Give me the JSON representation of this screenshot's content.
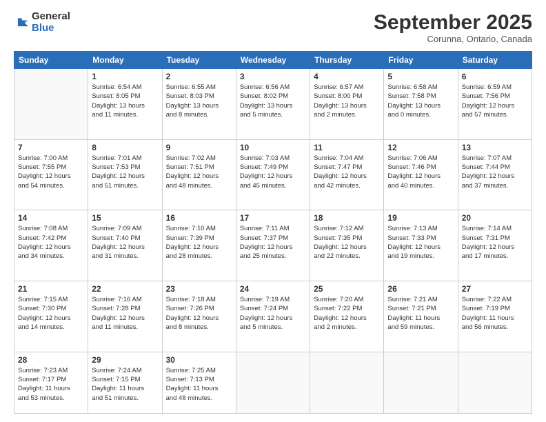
{
  "logo": {
    "general": "General",
    "blue": "Blue"
  },
  "title": "September 2025",
  "location": "Corunna, Ontario, Canada",
  "days_header": [
    "Sunday",
    "Monday",
    "Tuesday",
    "Wednesday",
    "Thursday",
    "Friday",
    "Saturday"
  ],
  "weeks": [
    [
      {
        "day": "",
        "info": ""
      },
      {
        "day": "1",
        "info": "Sunrise: 6:54 AM\nSunset: 8:05 PM\nDaylight: 13 hours\nand 11 minutes."
      },
      {
        "day": "2",
        "info": "Sunrise: 6:55 AM\nSunset: 8:03 PM\nDaylight: 13 hours\nand 8 minutes."
      },
      {
        "day": "3",
        "info": "Sunrise: 6:56 AM\nSunset: 8:02 PM\nDaylight: 13 hours\nand 5 minutes."
      },
      {
        "day": "4",
        "info": "Sunrise: 6:57 AM\nSunset: 8:00 PM\nDaylight: 13 hours\nand 2 minutes."
      },
      {
        "day": "5",
        "info": "Sunrise: 6:58 AM\nSunset: 7:58 PM\nDaylight: 13 hours\nand 0 minutes."
      },
      {
        "day": "6",
        "info": "Sunrise: 6:59 AM\nSunset: 7:56 PM\nDaylight: 12 hours\nand 57 minutes."
      }
    ],
    [
      {
        "day": "7",
        "info": "Sunrise: 7:00 AM\nSunset: 7:55 PM\nDaylight: 12 hours\nand 54 minutes."
      },
      {
        "day": "8",
        "info": "Sunrise: 7:01 AM\nSunset: 7:53 PM\nDaylight: 12 hours\nand 51 minutes."
      },
      {
        "day": "9",
        "info": "Sunrise: 7:02 AM\nSunset: 7:51 PM\nDaylight: 12 hours\nand 48 minutes."
      },
      {
        "day": "10",
        "info": "Sunrise: 7:03 AM\nSunset: 7:49 PM\nDaylight: 12 hours\nand 45 minutes."
      },
      {
        "day": "11",
        "info": "Sunrise: 7:04 AM\nSunset: 7:47 PM\nDaylight: 12 hours\nand 42 minutes."
      },
      {
        "day": "12",
        "info": "Sunrise: 7:06 AM\nSunset: 7:46 PM\nDaylight: 12 hours\nand 40 minutes."
      },
      {
        "day": "13",
        "info": "Sunrise: 7:07 AM\nSunset: 7:44 PM\nDaylight: 12 hours\nand 37 minutes."
      }
    ],
    [
      {
        "day": "14",
        "info": "Sunrise: 7:08 AM\nSunset: 7:42 PM\nDaylight: 12 hours\nand 34 minutes."
      },
      {
        "day": "15",
        "info": "Sunrise: 7:09 AM\nSunset: 7:40 PM\nDaylight: 12 hours\nand 31 minutes."
      },
      {
        "day": "16",
        "info": "Sunrise: 7:10 AM\nSunset: 7:39 PM\nDaylight: 12 hours\nand 28 minutes."
      },
      {
        "day": "17",
        "info": "Sunrise: 7:11 AM\nSunset: 7:37 PM\nDaylight: 12 hours\nand 25 minutes."
      },
      {
        "day": "18",
        "info": "Sunrise: 7:12 AM\nSunset: 7:35 PM\nDaylight: 12 hours\nand 22 minutes."
      },
      {
        "day": "19",
        "info": "Sunrise: 7:13 AM\nSunset: 7:33 PM\nDaylight: 12 hours\nand 19 minutes."
      },
      {
        "day": "20",
        "info": "Sunrise: 7:14 AM\nSunset: 7:31 PM\nDaylight: 12 hours\nand 17 minutes."
      }
    ],
    [
      {
        "day": "21",
        "info": "Sunrise: 7:15 AM\nSunset: 7:30 PM\nDaylight: 12 hours\nand 14 minutes."
      },
      {
        "day": "22",
        "info": "Sunrise: 7:16 AM\nSunset: 7:28 PM\nDaylight: 12 hours\nand 11 minutes."
      },
      {
        "day": "23",
        "info": "Sunrise: 7:18 AM\nSunset: 7:26 PM\nDaylight: 12 hours\nand 8 minutes."
      },
      {
        "day": "24",
        "info": "Sunrise: 7:19 AM\nSunset: 7:24 PM\nDaylight: 12 hours\nand 5 minutes."
      },
      {
        "day": "25",
        "info": "Sunrise: 7:20 AM\nSunset: 7:22 PM\nDaylight: 12 hours\nand 2 minutes."
      },
      {
        "day": "26",
        "info": "Sunrise: 7:21 AM\nSunset: 7:21 PM\nDaylight: 11 hours\nand 59 minutes."
      },
      {
        "day": "27",
        "info": "Sunrise: 7:22 AM\nSunset: 7:19 PM\nDaylight: 11 hours\nand 56 minutes."
      }
    ],
    [
      {
        "day": "28",
        "info": "Sunrise: 7:23 AM\nSunset: 7:17 PM\nDaylight: 11 hours\nand 53 minutes."
      },
      {
        "day": "29",
        "info": "Sunrise: 7:24 AM\nSunset: 7:15 PM\nDaylight: 11 hours\nand 51 minutes."
      },
      {
        "day": "30",
        "info": "Sunrise: 7:25 AM\nSunset: 7:13 PM\nDaylight: 11 hours\nand 48 minutes."
      },
      {
        "day": "",
        "info": ""
      },
      {
        "day": "",
        "info": ""
      },
      {
        "day": "",
        "info": ""
      },
      {
        "day": "",
        "info": ""
      }
    ]
  ]
}
